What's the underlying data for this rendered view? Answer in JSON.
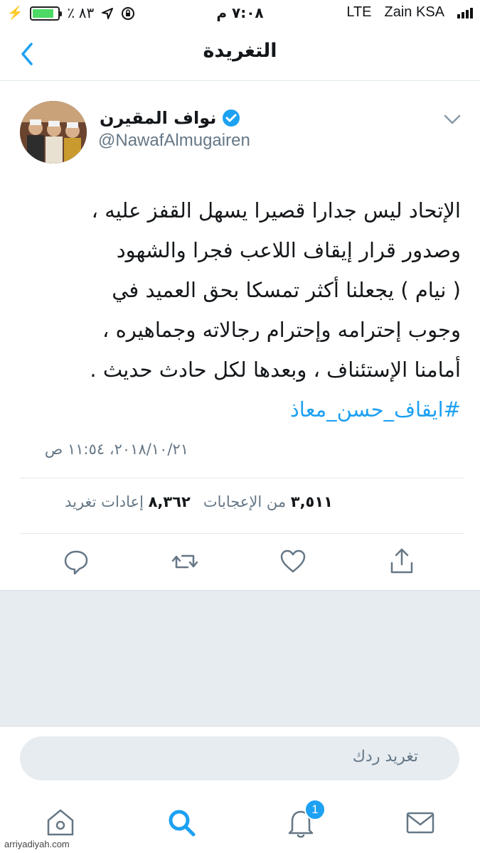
{
  "status_bar": {
    "battery_text": "٪ ٨٣",
    "time": "٧:٠٨ م",
    "network": "LTE",
    "carrier": "Zain KSA",
    "battery_level": 0.83
  },
  "nav": {
    "title": "التغريدة"
  },
  "tweet": {
    "author_name": "نواف المقيرن",
    "handle": "@NawafAlmugairen",
    "lines": [
      "الإتحاد ليس جدارا قصيرا يسهل القفز عليه ،",
      "وصدور قرار إيقاف اللاعب فجرا والشهود",
      "( نيام ) يجعلنا أكثر تمسكا بحق العميد في",
      "وجوب إحترامه وإحترام رجالاته وجماهيره ،",
      "أمامنا الإستئناف ، وبعدها لكل حادث حديث ."
    ],
    "hashtag": "#ايقاف_حسن_معاذ",
    "timestamp": "٢٠١٨/١٠/٢١، ١١:٥٤ ص",
    "retweets_count": "٣,٥١١",
    "retweets_label": "من الإعجابات",
    "likes_count": "٨,٣٦٢",
    "likes_label": "إعادات تغريد"
  },
  "reply": {
    "placeholder": "تغريد ردك"
  },
  "tabbar": {
    "notification_count": "1"
  },
  "watermark": "arriyadiyah.com",
  "colors": {
    "accent": "#1da1f2",
    "text": "#14171a",
    "muted": "#657786",
    "battery": "#4cd964"
  }
}
